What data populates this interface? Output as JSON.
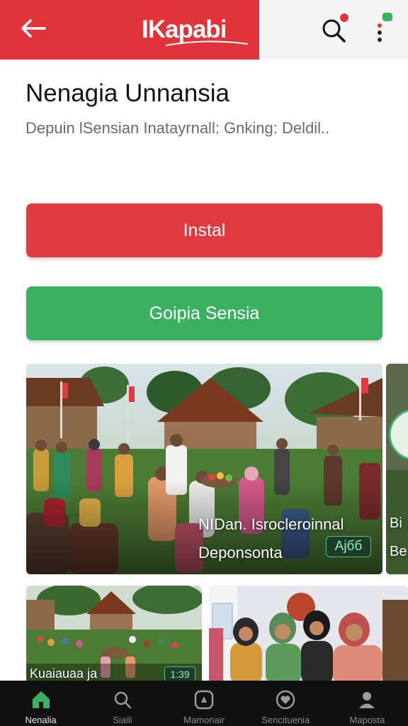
{
  "header": {
    "brand_name": "IKapabi",
    "back_icon": "back-arrow-icon",
    "search_icon": "search-icon",
    "menu_icon": "more-vert-icon",
    "brand_color": "#e0343a"
  },
  "app": {
    "title": "Nenagia Unnansia",
    "subtitle": "Depuin lSensian Inatayrnall: Gnking: Deldil.."
  },
  "actions": {
    "install_label": "Instal",
    "install_color": "#e03a3f",
    "secondary_label": "Goipia Sensia",
    "secondary_color": "#3bb061"
  },
  "gallery": {
    "main": {
      "caption_line1": "NIDan. Isrocleroinnal",
      "caption_line2": "Deponsonta",
      "badge": "Ajбб"
    },
    "peek": {
      "caption_line1": "Bi",
      "caption_line2": "Be"
    },
    "small1": {
      "caption": "Kuaiauaa ja",
      "badge": "1:39"
    }
  },
  "bottom_nav": {
    "items": [
      {
        "label": "Nenalia",
        "icon": "home-icon",
        "active": true
      },
      {
        "label": "Siaili",
        "icon": "search-icon",
        "active": false
      },
      {
        "label": "Mamonair",
        "icon": "compass-icon",
        "active": false
      },
      {
        "label": "Sencituenia",
        "icon": "heart-icon",
        "active": false
      },
      {
        "label": "Maposta",
        "icon": "profile-icon",
        "active": false
      }
    ]
  }
}
